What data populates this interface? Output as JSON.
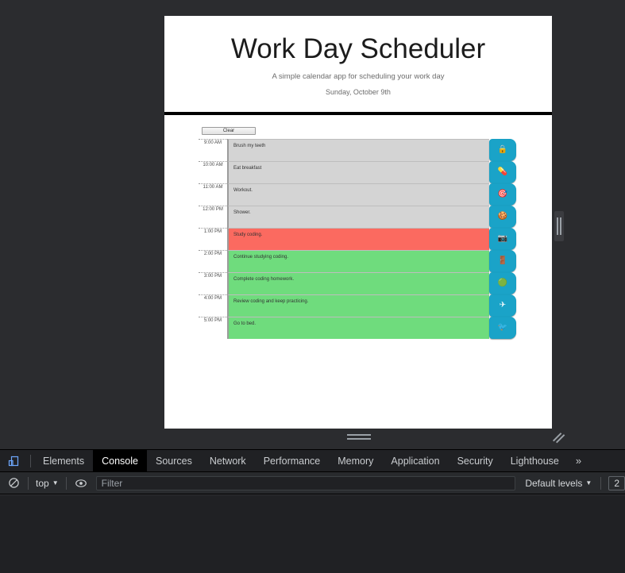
{
  "page": {
    "title": "Work Day Scheduler",
    "subtitle": "A simple calendar app for scheduling your work day",
    "currentDay": "Sunday, October 9th",
    "clear_label": "Clear"
  },
  "colors": {
    "past": "#d4d4d4",
    "present": "#fb6a60",
    "future": "#6fdc7d",
    "save_button": "#1aa3c8"
  },
  "schedule": [
    {
      "hour": "9:00 AM",
      "text": "Brush my teeth",
      "state": "past",
      "icon": "lock-icon",
      "glyph": "🔒"
    },
    {
      "hour": "10:00 AM",
      "text": "Eat breakfast",
      "state": "past",
      "icon": "pill-icon",
      "glyph": "💊"
    },
    {
      "hour": "11:00 AM",
      "text": "Workout.",
      "state": "past",
      "icon": "dart-icon",
      "glyph": "🎯"
    },
    {
      "hour": "12:00 PM",
      "text": "Shower.",
      "state": "past",
      "icon": "cookie-icon",
      "glyph": "🍪"
    },
    {
      "hour": "1:00 PM",
      "text": "Study coding.",
      "state": "present",
      "icon": "camera-icon",
      "glyph": "📷"
    },
    {
      "hour": "2:00 PM",
      "text": "Continue studying coding.",
      "state": "future",
      "icon": "door-icon",
      "glyph": "🚪"
    },
    {
      "hour": "3:00 PM",
      "text": "Complete coding homework.",
      "state": "future",
      "icon": "green-ball-icon",
      "glyph": "🟢"
    },
    {
      "hour": "4:00 PM",
      "text": "Review coding and keep practicing.",
      "state": "future",
      "icon": "airplane-icon",
      "glyph": "✈"
    },
    {
      "hour": "5:00 PM",
      "text": "Go to bed.",
      "state": "future",
      "icon": "bird-icon",
      "glyph": "🐦"
    }
  ],
  "devtools": {
    "tabs": [
      {
        "label": "Elements",
        "active": false
      },
      {
        "label": "Console",
        "active": true
      },
      {
        "label": "Sources",
        "active": false
      },
      {
        "label": "Network",
        "active": false
      },
      {
        "label": "Performance",
        "active": false
      },
      {
        "label": "Memory",
        "active": false
      },
      {
        "label": "Application",
        "active": false
      },
      {
        "label": "Security",
        "active": false
      },
      {
        "label": "Lighthouse",
        "active": false
      }
    ],
    "more_label": "»",
    "context_label": "top",
    "filter_placeholder": "Filter",
    "levels_label": "Default levels",
    "issues_count": "2"
  }
}
